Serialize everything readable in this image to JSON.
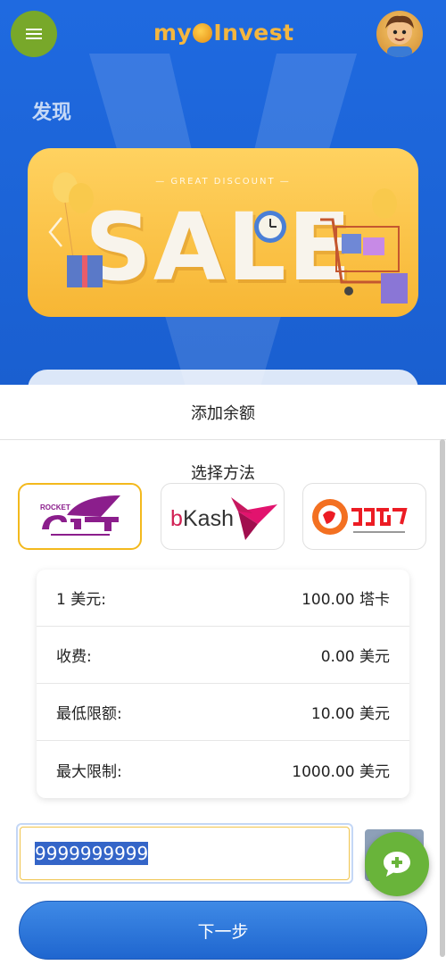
{
  "app": {
    "logo_text_left": "my",
    "logo_text_right": "Invest",
    "section_title": "发现"
  },
  "banner": {
    "tagline": "— GREAT DISCOUNT —",
    "headline": "SALE"
  },
  "dialog": {
    "title": "添加余额",
    "choose_method": "选择方法",
    "methods": [
      {
        "name": "Rocket",
        "selected": true
      },
      {
        "name": "bKash",
        "selected": false
      },
      {
        "name": "Nagad",
        "selected": false
      }
    ],
    "rows": [
      {
        "label": "1 美元:",
        "value": "100.00 塔卡"
      },
      {
        "label": "收费:",
        "value": "0.00 美元"
      },
      {
        "label": "最低限额:",
        "value": "10.00 美元"
      },
      {
        "label": "最大限制:",
        "value": "1000.00 美元"
      }
    ],
    "amount_value": "9999999999",
    "next_label": "下一步"
  },
  "colors": {
    "primary": "#1f66cf",
    "accent": "#f3b91d",
    "fab": "#69b43a"
  },
  "icons": {
    "menu": "hamburger-icon",
    "chat": "chat-plus-icon",
    "chevron": "chevron-left-icon"
  }
}
